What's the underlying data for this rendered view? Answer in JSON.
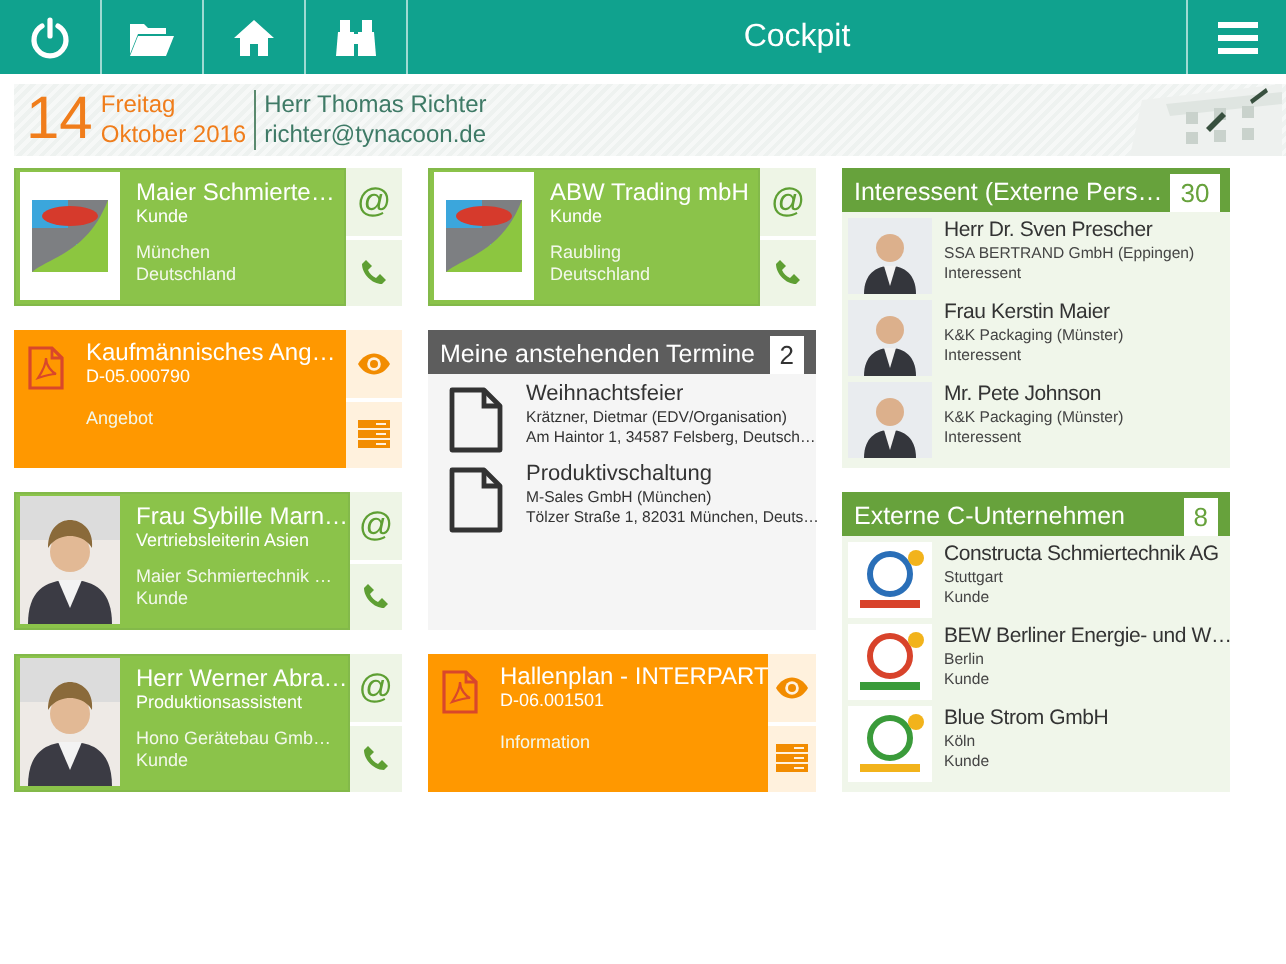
{
  "topbar": {
    "buttons": [
      {
        "kind": "power"
      },
      {
        "kind": "folder"
      },
      {
        "kind": "home"
      },
      {
        "kind": "binoculars"
      }
    ],
    "title": "Cockpit",
    "menu": {
      "kind": "menu"
    }
  },
  "header": {
    "day": "14",
    "weekday": "Freitag",
    "month_year": "Oktober 2016",
    "user": "Herr Thomas Richter",
    "email": "richter@tynacoon.de"
  },
  "columns": [
    {
      "widgets": [
        {
          "kind": "contact",
          "portrait": false,
          "title": "Maier Schmierte…",
          "subtitle": "Kunde",
          "lines": [
            "München",
            "Deutschland"
          ],
          "actions": [
            {
              "kind": "email",
              "symbol": "@"
            },
            {
              "kind": "phone"
            }
          ]
        },
        {
          "kind": "document",
          "title": "Kaufmännisches Ang…",
          "subtitle": "D-05.000790",
          "lines": [
            "Angebot"
          ],
          "actions": [
            {
              "kind": "view"
            },
            {
              "kind": "details"
            }
          ]
        },
        {
          "kind": "contact",
          "portrait": true,
          "title": "Frau Sybille Marn…",
          "subtitle": "Vertriebsleiterin Asien",
          "lines": [
            "Maier Schmiertechnik …",
            "Kunde"
          ],
          "actions": [
            {
              "kind": "email",
              "symbol": "@"
            },
            {
              "kind": "phone"
            }
          ]
        },
        {
          "kind": "contact",
          "portrait": true,
          "title": "Herr Werner Abra…",
          "subtitle": "Produktionsassistent",
          "lines": [
            "Hono Gerätebau Gmb…",
            "Kunde"
          ],
          "actions": [
            {
              "kind": "email",
              "symbol": "@"
            },
            {
              "kind": "phone"
            }
          ]
        }
      ]
    },
    {
      "widgets": [
        {
          "kind": "contact",
          "portrait": false,
          "title": "ABW Trading mbH",
          "subtitle": "Kunde",
          "lines": [
            "Raubling",
            "Deutschland"
          ],
          "actions": [
            {
              "kind": "email",
              "symbol": "@"
            },
            {
              "kind": "phone"
            }
          ]
        },
        {
          "kind": "appointments",
          "title": "Meine anstehenden Termine",
          "count": "2",
          "items": [
            {
              "title": "Weihnachtsfeier",
              "lines": [
                "Krätzner, Dietmar (EDV/Organisation)",
                "Am Haintor 1, 34587 Felsberg, Deutsch…"
              ]
            },
            {
              "title": "Produktivschaltung",
              "lines": [
                "M-Sales GmbH (München)",
                "Tölzer Straße 1, 82031 München, Deuts…"
              ]
            }
          ]
        },
        {
          "kind": "document",
          "title": "Hallenplan - INTERPART",
          "subtitle": "D-06.001501",
          "lines": [
            "Information"
          ],
          "actions": [
            {
              "kind": "view"
            },
            {
              "kind": "details"
            }
          ]
        }
      ]
    },
    {
      "widgets": [
        {
          "kind": "people",
          "title": "Interessent (Externe Pers…",
          "count": "30",
          "items": [
            {
              "portrait": true,
              "title": "Herr Dr. Sven Prescher",
              "lines": [
                "SSA BERTRAND GmbH (Eppingen)",
                "Interessent"
              ]
            },
            {
              "portrait": true,
              "title": "Frau Kerstin Maier",
              "lines": [
                "K&K Packaging (Münster)",
                "Interessent"
              ]
            },
            {
              "portrait": true,
              "title": "Mr. Pete Johnson",
              "lines": [
                "K&K Packaging (Münster)",
                "Interessent"
              ]
            }
          ]
        },
        {
          "kind": "people",
          "title": "Externe C-Unternehmen",
          "count": "8",
          "items": [
            {
              "portrait": false,
              "title": "Constructa Schmiertechnik AG",
              "lines": [
                "Stuttgart",
                "Kunde"
              ]
            },
            {
              "portrait": false,
              "title": "BEW Berliner Energie- und W…",
              "lines": [
                "Berlin",
                "Kunde"
              ]
            },
            {
              "portrait": false,
              "title": "Blue Strom GmbH",
              "lines": [
                "Köln",
                "Kunde"
              ]
            }
          ]
        }
      ]
    }
  ]
}
